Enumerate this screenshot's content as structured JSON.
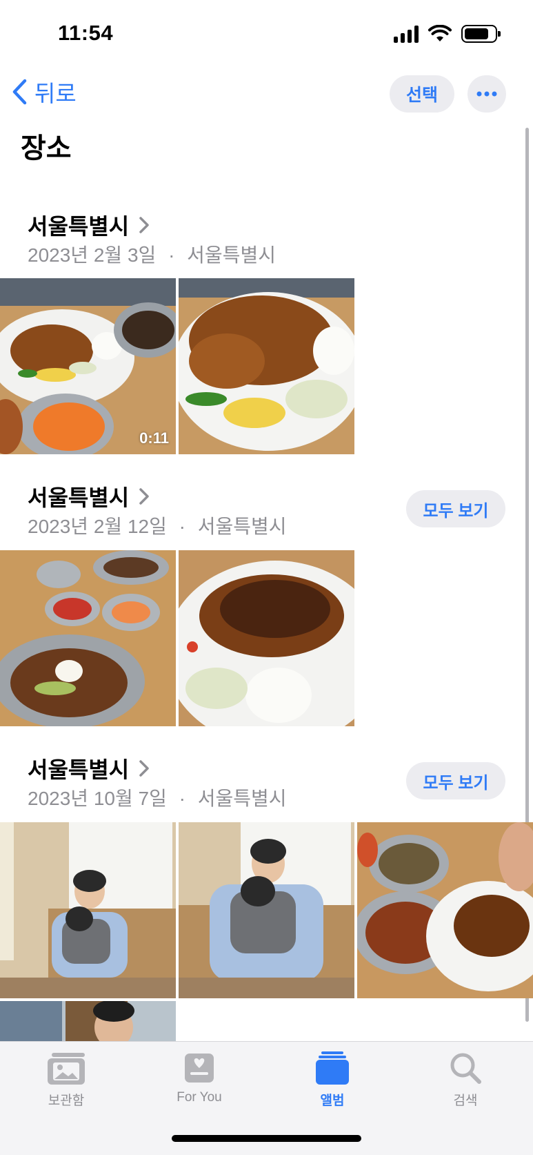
{
  "status_bar": {
    "time": "11:54"
  },
  "nav": {
    "back_label": "뒤로",
    "select_label": "선택"
  },
  "page": {
    "title": "장소"
  },
  "sections": [
    {
      "title": "서울특별시",
      "date": "2023년 2월 3일",
      "location": "서울특별시",
      "see_all": ""
    },
    {
      "title": "서울특별시",
      "date": "2023년 2월 12일",
      "location": "서울특별시",
      "see_all": "모두 보기"
    },
    {
      "title": "서울특별시",
      "date": "2023년 10월 7일",
      "location": "서울특별시",
      "see_all": "모두 보기"
    }
  ],
  "separator": "·",
  "photos": {
    "video_duration": "0:11"
  },
  "tabs": [
    {
      "label": "보관함",
      "icon": "photos-library-icon",
      "active": false
    },
    {
      "label": "For You",
      "icon": "for-you-icon",
      "active": false
    },
    {
      "label": "앨범",
      "icon": "albums-icon",
      "active": true
    },
    {
      "label": "검색",
      "icon": "search-icon",
      "active": false
    }
  ],
  "colors": {
    "accent": "#2f7bf6",
    "secondary_text": "#8e8e93",
    "pill_bg": "#ececf0"
  }
}
